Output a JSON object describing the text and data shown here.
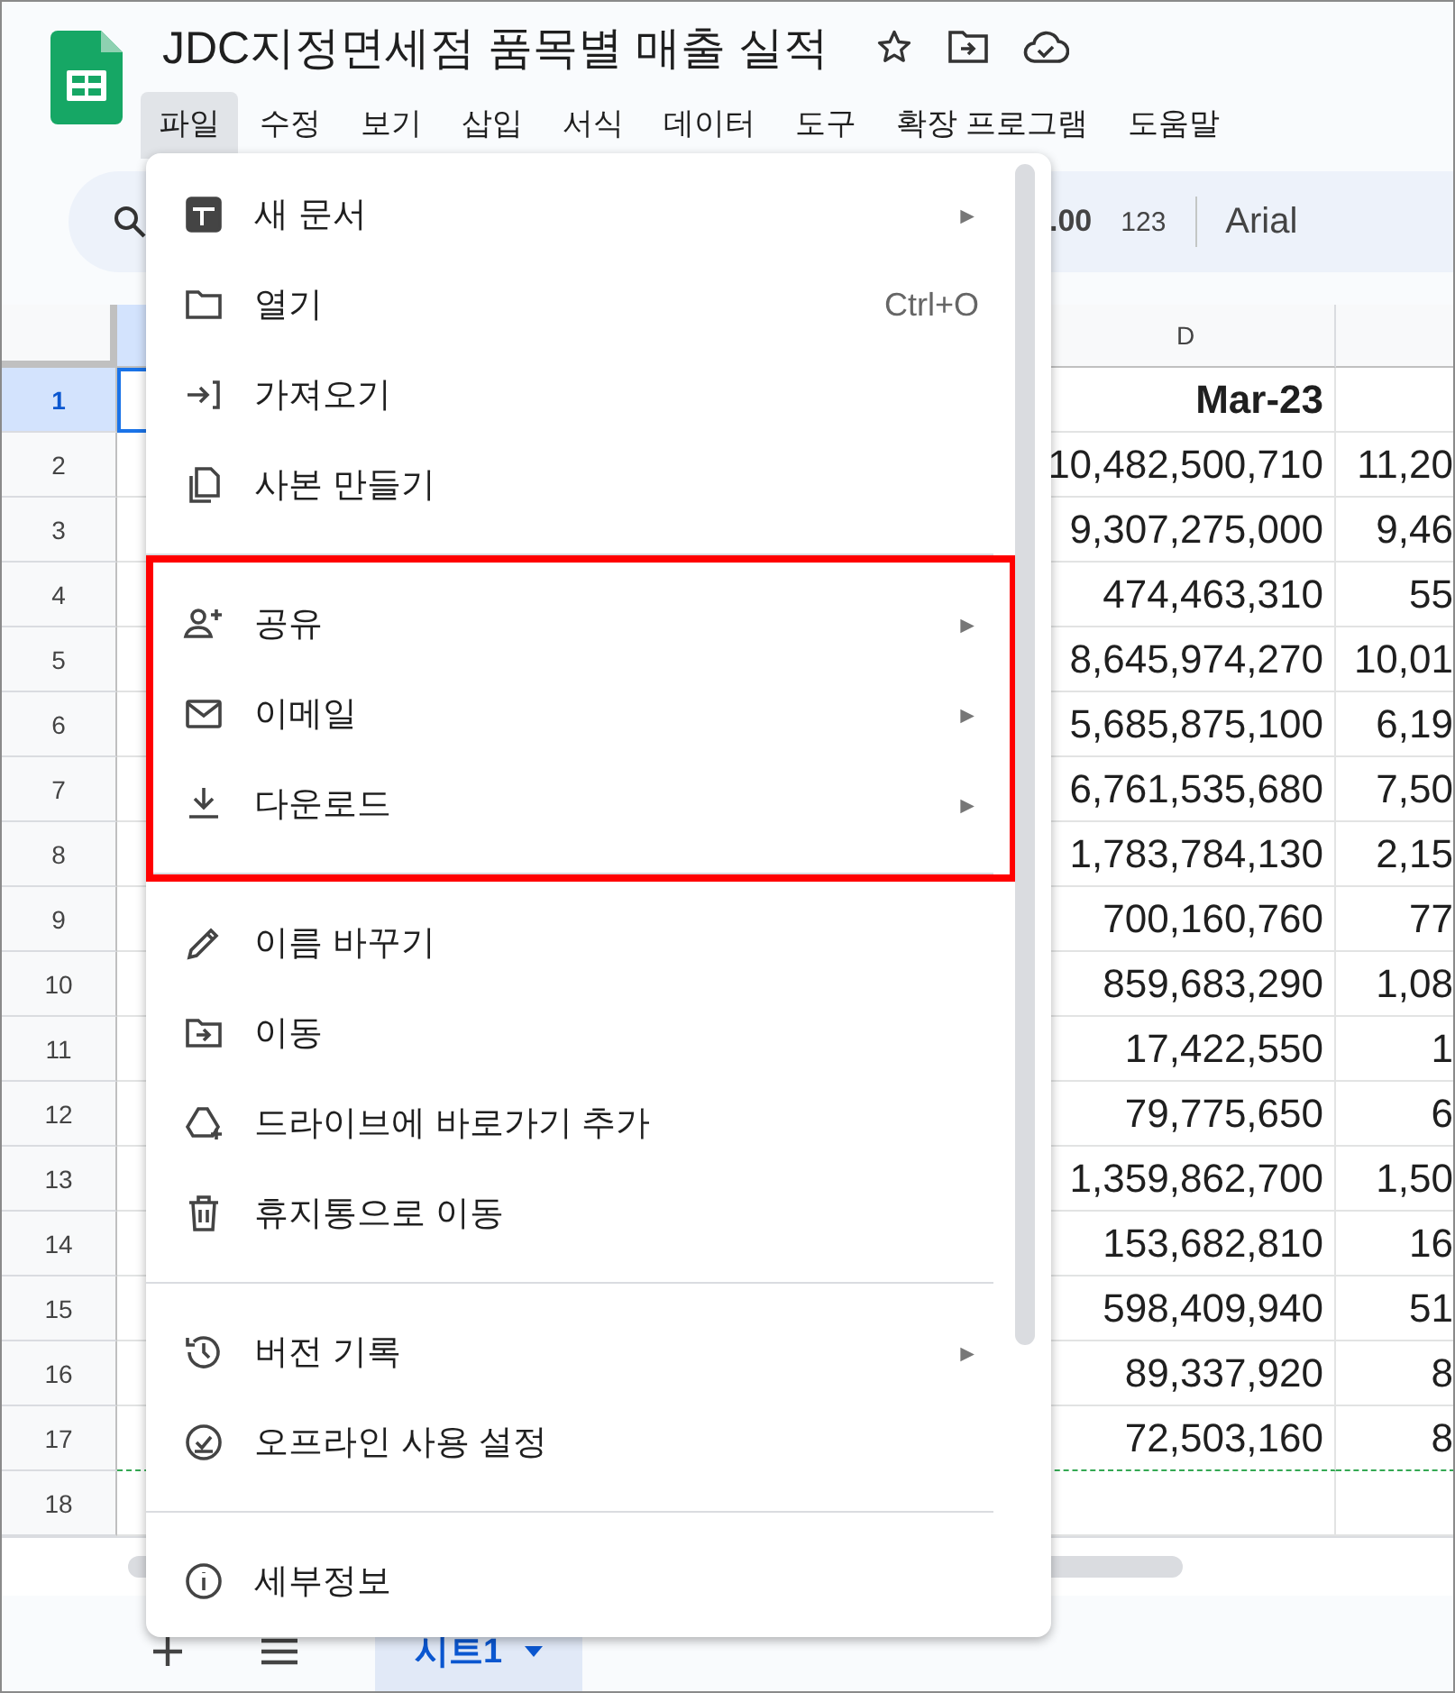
{
  "document": {
    "title": "JDC지정면세점 품목별 매출 실적"
  },
  "menubar": [
    {
      "label": "파일",
      "selected": true
    },
    {
      "label": "수정",
      "selected": false
    },
    {
      "label": "보기",
      "selected": false
    },
    {
      "label": "삽입",
      "selected": false
    },
    {
      "label": "서식",
      "selected": false
    },
    {
      "label": "데이터",
      "selected": false
    },
    {
      "label": "도구",
      "selected": false
    },
    {
      "label": "확장 프로그램",
      "selected": false
    },
    {
      "label": "도움말",
      "selected": false
    }
  ],
  "toolbar": {
    "decimal_label": ".00",
    "format_label": "123",
    "font": "Arial"
  },
  "columns": [
    {
      "label": "D"
    }
  ],
  "rows": [
    {
      "number": "1",
      "selected": true,
      "column_d": "Mar-23",
      "bold": true
    },
    {
      "number": "2",
      "selected": false,
      "column_d": "10,482,500,710",
      "column_e": "11,20",
      "bold": false
    },
    {
      "number": "3",
      "selected": false,
      "column_d": "9,307,275,000",
      "column_e": "9,46",
      "bold": false
    },
    {
      "number": "4",
      "selected": false,
      "column_d": "474,463,310",
      "column_e": "55",
      "bold": false
    },
    {
      "number": "5",
      "selected": false,
      "column_d": "8,645,974,270",
      "column_e": "10,01",
      "bold": false
    },
    {
      "number": "6",
      "selected": false,
      "column_d": "5,685,875,100",
      "column_e": "6,19",
      "bold": false
    },
    {
      "number": "7",
      "selected": false,
      "column_d": "6,761,535,680",
      "column_e": "7,50",
      "bold": false
    },
    {
      "number": "8",
      "selected": false,
      "column_d": "1,783,784,130",
      "column_e": "2,15",
      "bold": false
    },
    {
      "number": "9",
      "selected": false,
      "column_d": "700,160,760",
      "column_e": "77",
      "bold": false
    },
    {
      "number": "10",
      "selected": false,
      "column_d": "859,683,290",
      "column_e": "1,08",
      "bold": false
    },
    {
      "number": "11",
      "selected": false,
      "column_d": "17,422,550",
      "column_e": "1",
      "bold": false
    },
    {
      "number": "12",
      "selected": false,
      "column_d": "79,775,650",
      "column_e": "6",
      "bold": false
    },
    {
      "number": "13",
      "selected": false,
      "column_d": "1,359,862,700",
      "column_e": "1,50",
      "bold": false
    },
    {
      "number": "14",
      "selected": false,
      "column_d": "153,682,810",
      "column_e": "16",
      "bold": false
    },
    {
      "number": "15",
      "selected": false,
      "column_d": "598,409,940",
      "column_e": "51",
      "bold": false
    },
    {
      "number": "16",
      "selected": false,
      "column_d": "89,337,920",
      "column_e": "8",
      "bold": false
    },
    {
      "number": "17",
      "selected": false,
      "column_d": "72,503,160",
      "column_e": "8",
      "bold": false
    },
    {
      "number": "18",
      "selected": false
    }
  ],
  "sheet_tabs": [
    {
      "label": "시트1",
      "selected": true
    }
  ],
  "menu": {
    "sections": [
      {
        "highlighted": false,
        "items": [
          {
            "kind": "new-doc",
            "label": "새 문서",
            "submenu": true
          },
          {
            "kind": "folder",
            "label": "열기",
            "shortcut": "Ctrl+O",
            "submenu": false
          },
          {
            "kind": "import",
            "label": "가져오기",
            "submenu": false
          },
          {
            "kind": "copy",
            "label": "사본 만들기",
            "submenu": false
          }
        ]
      },
      {
        "highlighted": true,
        "items": [
          {
            "kind": "share",
            "label": "공유",
            "submenu": true
          },
          {
            "kind": "email",
            "label": "이메일",
            "submenu": true
          },
          {
            "kind": "download",
            "label": "다운로드",
            "submenu": true
          }
        ]
      },
      {
        "highlighted": false,
        "items": [
          {
            "kind": "rename",
            "label": "이름 바꾸기",
            "submenu": false
          },
          {
            "kind": "move",
            "label": "이동",
            "submenu": false
          },
          {
            "kind": "drive-shortcut",
            "label": "드라이브에 바로가기 추가",
            "submenu": false
          },
          {
            "kind": "trash",
            "label": "휴지통으로 이동",
            "submenu": false
          }
        ]
      },
      {
        "highlighted": false,
        "items": [
          {
            "kind": "history",
            "label": "버전 기록",
            "submenu": true
          },
          {
            "kind": "offline",
            "label": "오프라인 사용 설정",
            "submenu": false
          }
        ]
      },
      {
        "highlighted": false,
        "items": [
          {
            "kind": "info",
            "label": "세부정보",
            "submenu": false
          }
        ]
      }
    ],
    "submenu_arrow": "►"
  }
}
